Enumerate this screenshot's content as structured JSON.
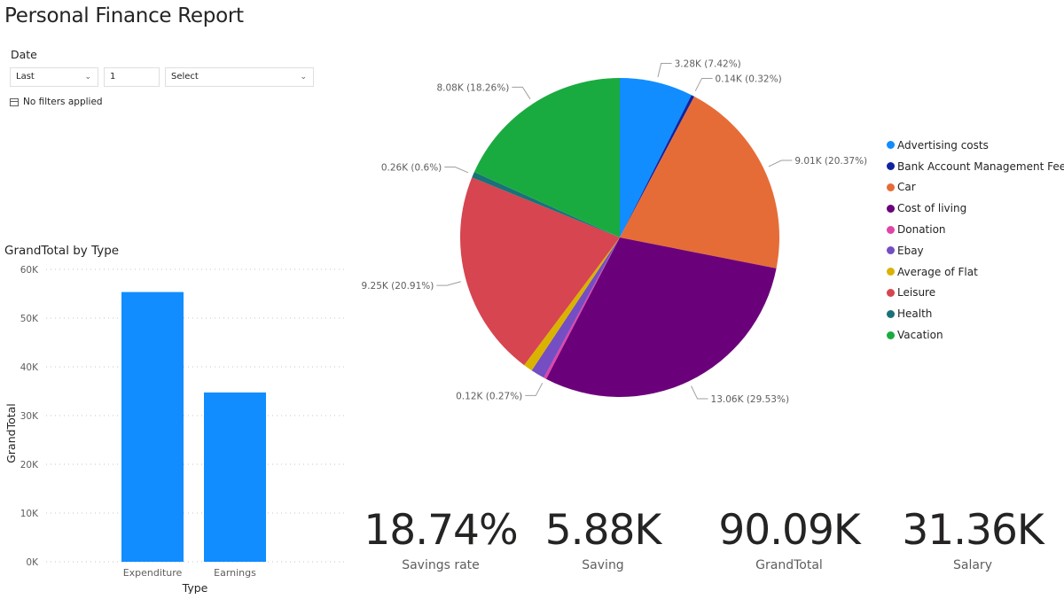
{
  "report": {
    "title": "Personal Finance Report"
  },
  "slicer": {
    "label": "Date",
    "mode": "Last",
    "count": "1",
    "period_placeholder": "Select",
    "status": "No filters applied",
    "chevron_icon": "chevron-down-icon",
    "calendar_icon": "calendar-icon"
  },
  "bar_title": "GrandTotal by Type",
  "legend": [
    {
      "label": "Advertising costs",
      "color": "#118DFF"
    },
    {
      "label": "Bank Account Management Fee",
      "color": "#12239E"
    },
    {
      "label": "Car",
      "color": "#E66C37"
    },
    {
      "label": "Cost of living",
      "color": "#6B007B"
    },
    {
      "label": "Donation",
      "color": "#E044A7"
    },
    {
      "label": "Ebay",
      "color": "#744EC2"
    },
    {
      "label": "Average of Flat",
      "color": "#D9B300"
    },
    {
      "label": "Leisure",
      "color": "#D64550"
    },
    {
      "label": "Health",
      "color": "#197278"
    },
    {
      "label": "Vacation",
      "color": "#1AAB40"
    }
  ],
  "kpis": [
    {
      "value": "18.74%",
      "label": "Savings rate"
    },
    {
      "value": "5.88K",
      "label": "Saving"
    },
    {
      "value": "90.09K",
      "label": "GrandTotal"
    },
    {
      "value": "31.36K",
      "label": "Salary"
    }
  ],
  "chart_data": [
    {
      "type": "bar",
      "title": "GrandTotal by Type",
      "categories": [
        "Expenditure",
        "Earnings"
      ],
      "values": [
        55350,
        34740
      ],
      "xlabel": "Type",
      "ylabel": "GrandTotal",
      "ylim": [
        0,
        60000
      ],
      "yticks": [
        0,
        10000,
        20000,
        30000,
        40000,
        50000,
        60000
      ],
      "ytick_labels": [
        "0K",
        "10K",
        "20K",
        "30K",
        "40K",
        "50K",
        "60K"
      ],
      "grid": true,
      "color": "#118DFF"
    },
    {
      "type": "pie",
      "legend_position": "right",
      "slices": [
        {
          "name": "Advertising costs",
          "value": 3.28,
          "percent": 7.42,
          "label": "3.28K (7.42%)",
          "color": "#118DFF"
        },
        {
          "name": "Bank Account Management Fee",
          "value": 0.14,
          "percent": 0.32,
          "label": "0.14K (0.32%)",
          "color": "#12239E"
        },
        {
          "name": "Car",
          "value": 9.01,
          "percent": 20.37,
          "label": "9.01K (20.37%)",
          "color": "#E66C37"
        },
        {
          "name": "Cost of living",
          "value": 13.06,
          "percent": 29.53,
          "label": "13.06K (29.53%)",
          "color": "#6B007B"
        },
        {
          "name": "Donation",
          "value": 0.12,
          "percent": 0.27,
          "label": "0.12K (0.27%)",
          "color": "#E044A7"
        },
        {
          "name": "Ebay",
          "value": 0.62,
          "percent": 1.4,
          "label": "",
          "color": "#744EC2"
        },
        {
          "name": "Average of Flat",
          "value": 0.41,
          "percent": 0.92,
          "label": "",
          "color": "#D9B300"
        },
        {
          "name": "Leisure",
          "value": 9.25,
          "percent": 20.91,
          "label": "9.25K (20.91%)",
          "color": "#D64550"
        },
        {
          "name": "Health",
          "value": 0.26,
          "percent": 0.6,
          "label": "0.26K (0.6%)",
          "color": "#197278"
        },
        {
          "name": "Vacation",
          "value": 8.08,
          "percent": 18.26,
          "label": "8.08K (18.26%)",
          "color": "#1AAB40"
        }
      ]
    }
  ]
}
